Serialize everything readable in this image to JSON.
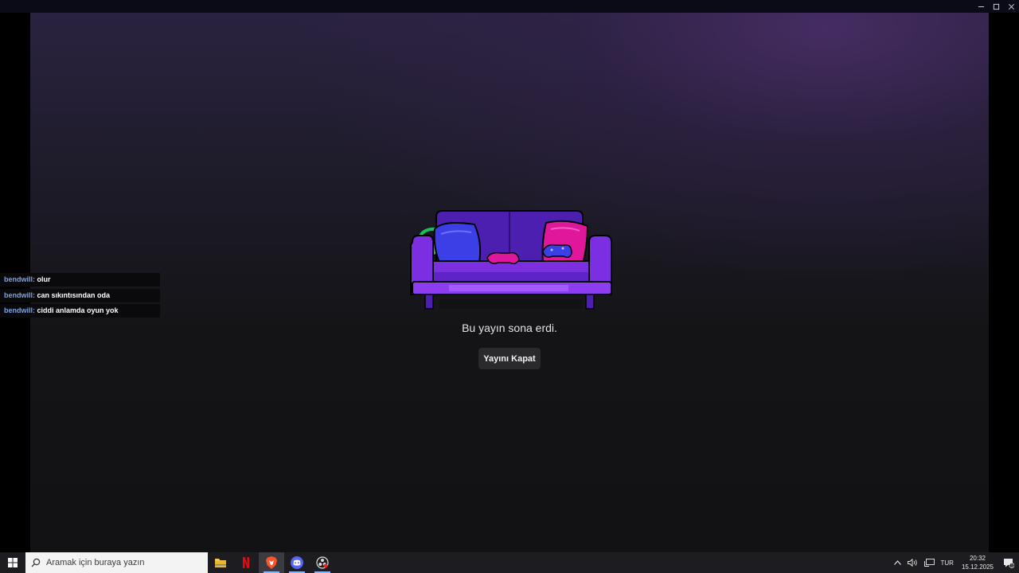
{
  "stream": {
    "ended_message": "Bu yayın sona erdi.",
    "close_button": "Yayını Kapat"
  },
  "chat": {
    "messages": [
      {
        "user": "bendwill",
        "text": "olur"
      },
      {
        "user": "bendwill",
        "text": "can sıkıntısından oda"
      },
      {
        "user": "bendwill",
        "text": "ciddi anlamda oyun yok"
      }
    ]
  },
  "taskbar": {
    "search_placeholder": "Aramak için buraya yazın",
    "apps": [
      "file-explorer-icon",
      "netflix-icon",
      "brave-icon",
      "discord-icon",
      "obs-icon"
    ],
    "language": "TUR",
    "time": "20:32",
    "date": "15.12.2025",
    "notification_count": "1"
  },
  "colors": {
    "accent": "#8ab4f8",
    "chat_username": "#7fa3e3",
    "couch_purple": "#7b2fe0",
    "pillow_pink": "#e0179b"
  }
}
